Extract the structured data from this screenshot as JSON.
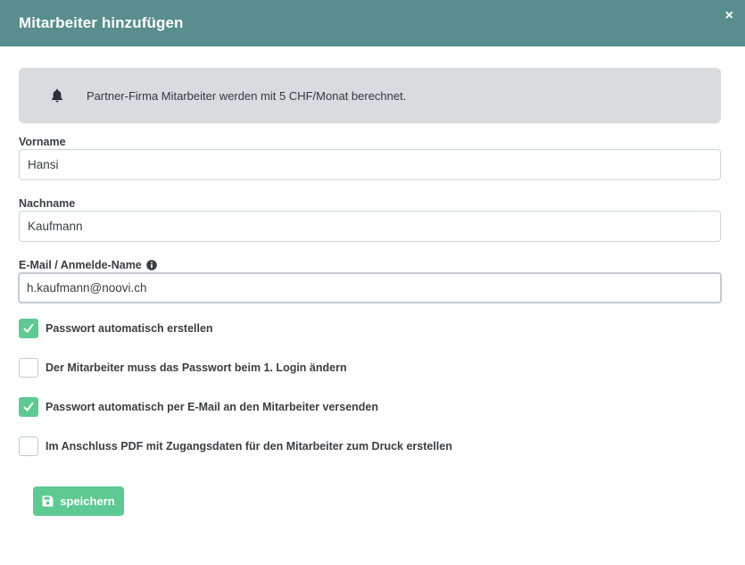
{
  "modal": {
    "title": "Mitarbeiter hinzufügen",
    "close_label": "×"
  },
  "alert": {
    "icon": "bell-icon",
    "text": "Partner-Firma Mitarbeiter werden mit 5 CHF/Monat berechnet."
  },
  "form": {
    "first_name": {
      "label": "Vorname",
      "value": "Hansi"
    },
    "last_name": {
      "label": "Nachname",
      "value": "Kaufmann"
    },
    "email": {
      "label": "E-Mail / Anmelde-Name",
      "value": "h.kaufmann@noovi.ch",
      "info_icon": "info-circle-icon"
    }
  },
  "options": [
    {
      "label": "Passwort automatisch erstellen",
      "checked": true
    },
    {
      "label": "Der Mitarbeiter muss das Passwort beim 1. Login ändern",
      "checked": false
    },
    {
      "label": "Passwort automatisch per E-Mail an den Mitarbeiter versenden",
      "checked": true
    },
    {
      "label": "Im Anschluss PDF mit Zugangsdaten für den Mitarbeiter zum Druck erstellen",
      "checked": false
    }
  ],
  "actions": {
    "save_label": "speichern",
    "save_icon": "floppy-disk-icon"
  },
  "colors": {
    "header": "#5a8e8e",
    "accent": "#5ec993",
    "alert_bg": "#d9dcdf"
  }
}
